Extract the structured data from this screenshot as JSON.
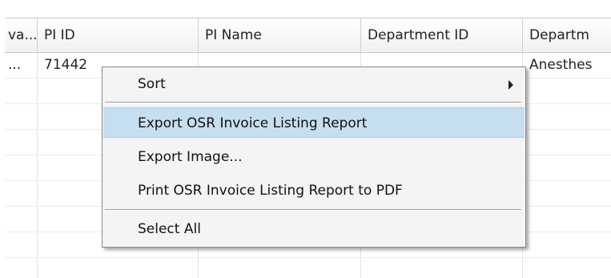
{
  "table": {
    "columns": [
      "va...",
      "PI ID",
      "PI Name",
      "Department ID",
      "Departm"
    ],
    "rows": [
      [
        "...",
        "71442",
        "",
        "",
        "Anesthes"
      ]
    ]
  },
  "context_menu": {
    "items": [
      {
        "label": "Sort",
        "submenu": true
      },
      {
        "label": "Export OSR Invoice Listing Report",
        "highlighted": true
      },
      {
        "label": "Export Image..."
      },
      {
        "label": "Print OSR Invoice Listing Report to PDF"
      },
      {
        "label": "Select All"
      }
    ]
  },
  "colors": {
    "highlight": "#c5dff0",
    "menu_background": "#f4f4f4",
    "menu_border": "#8a8a8a"
  }
}
